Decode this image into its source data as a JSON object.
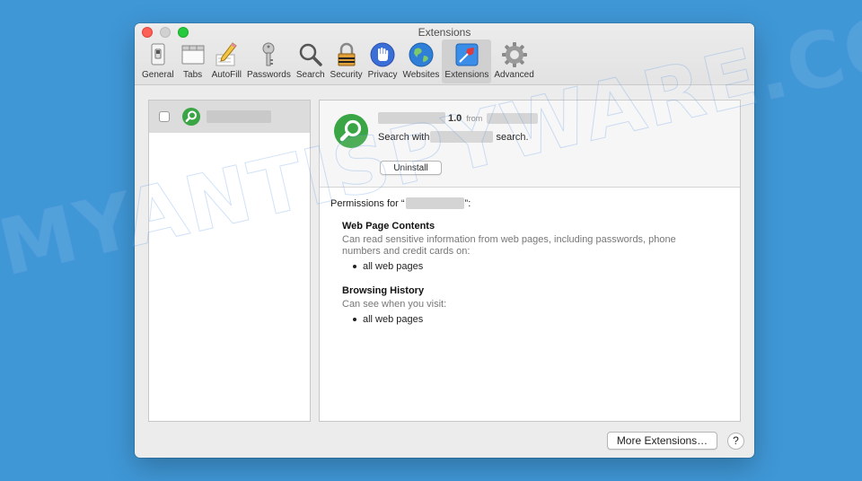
{
  "window": {
    "title": "Extensions"
  },
  "toolbar": {
    "items": [
      {
        "label": "General",
        "icon": "general-switch-icon"
      },
      {
        "label": "Tabs",
        "icon": "tabs-icon"
      },
      {
        "label": "AutoFill",
        "icon": "pencil-icon"
      },
      {
        "label": "Passwords",
        "icon": "key-icon"
      },
      {
        "label": "Search",
        "icon": "magnifier-icon"
      },
      {
        "label": "Security",
        "icon": "lock-icon"
      },
      {
        "label": "Privacy",
        "icon": "hand-icon"
      },
      {
        "label": "Websites",
        "icon": "globe-icon"
      },
      {
        "label": "Extensions",
        "icon": "puzzle-icon",
        "selected": true
      },
      {
        "label": "Advanced",
        "icon": "gear-icon"
      }
    ]
  },
  "extension": {
    "version": "1.0",
    "from_label": "from",
    "search_prefix": "Search with",
    "search_suffix": "search.",
    "uninstall_label": "Uninstall",
    "icon": "green-magnifier-icon",
    "icon_color": "#3aa544"
  },
  "permissions": {
    "header_prefix": "Permissions for “",
    "header_suffix": "”:",
    "sections": [
      {
        "title": "Web Page Contents",
        "description": "Can read sensitive information from web pages, including passwords, phone numbers and credit cards on:",
        "items": [
          "all web pages"
        ]
      },
      {
        "title": "Browsing History",
        "description": "Can see when you visit:",
        "items": [
          "all web pages"
        ]
      }
    ]
  },
  "footer": {
    "more_extensions_label": "More Extensions…",
    "help_label": "?"
  },
  "watermark": {
    "text": "MYANTISPYWARE.COM"
  },
  "colors": {
    "desktop": "#3f97d6",
    "selected_row": "#dcdcdc",
    "close": "#fe5f57",
    "zoom": "#27c93f"
  }
}
